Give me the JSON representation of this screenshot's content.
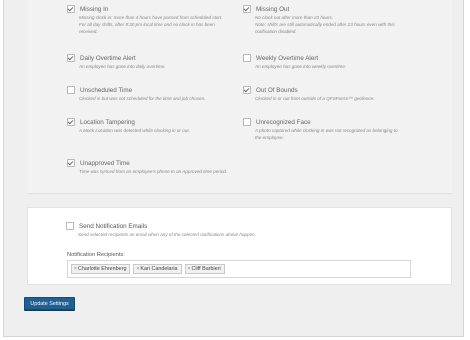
{
  "alerts": [
    {
      "title": "Missing In",
      "checked": true,
      "desc": [
        "Missing clock in: more than 4 hours have passed from scheduled start.",
        "For all day shifts, after 8:30 pm local time and no clock in has been",
        "received."
      ]
    },
    {
      "title": "Missing Out",
      "checked": true,
      "desc": [
        "No clock out after more than 23 hours.",
        "Note: shifts are still automatically ended after 23 hours even with this",
        "notification disabled."
      ]
    },
    {
      "title": "Daily Overtime Alert",
      "checked": true,
      "desc": [
        "An employee has gone into daily overtime."
      ]
    },
    {
      "title": "Weekly Overtime Alert",
      "checked": false,
      "desc": [
        "An employee has gone into weekly overtime."
      ]
    },
    {
      "title": "Unscheduled Time",
      "checked": false,
      "desc": [
        "Clocked in but was not scheduled for the time and job chosen."
      ]
    },
    {
      "title": "Out Of Bounds",
      "checked": true,
      "desc": [
        "Clocked in or out from outside of a QFSFence™ geofence."
      ]
    },
    {
      "title": "Location Tampering",
      "checked": true,
      "desc": [
        "A Mock Location was detected while clocking in or out."
      ]
    },
    {
      "title": "Unrecognized Face",
      "checked": false,
      "desc": [
        "A photo captured while clocking in was not recognized as belonging to",
        "the employee."
      ]
    },
    {
      "title": "Unapproved Time",
      "checked": true,
      "desc": [
        "Time was synced from an employee's phone to an Approved time period."
      ]
    }
  ],
  "email": {
    "title": "Send Notification Emails",
    "checked": false,
    "desc": "Send selected recipients an email when any of the selected notifications above happen.",
    "recipients_label": "Notification Recipients:",
    "recipients": [
      "Charlotte Ehrenberg",
      "Kari Candelaria",
      "Cliff Barbieri"
    ],
    "remove_symbol": "×"
  },
  "update_button": "Update Settings",
  "colors": {
    "button": "#1f5f92",
    "panel_bg": "#f2f2f2",
    "frame_bg": "#efefef"
  }
}
